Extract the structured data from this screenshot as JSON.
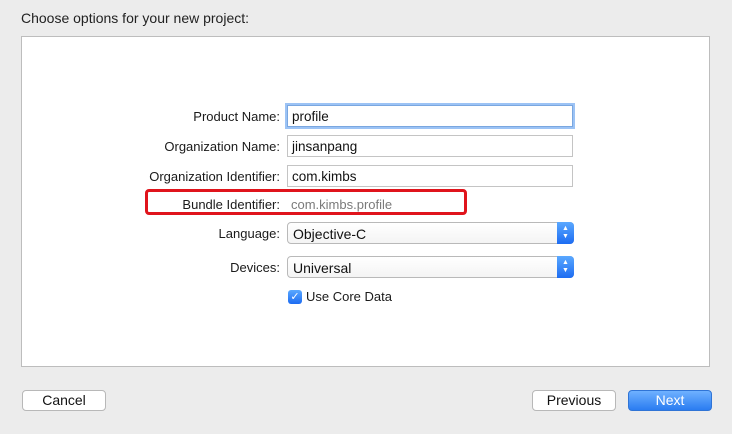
{
  "sheet": {
    "title": "Choose options for your new project:"
  },
  "form": {
    "product_name": {
      "label": "Product Name:",
      "value": "profile"
    },
    "organization_name": {
      "label": "Organization Name:",
      "value": "jinsanpang"
    },
    "organization_identifier": {
      "label": "Organization Identifier:",
      "value": "com.kimbs"
    },
    "bundle_identifier": {
      "label": "Bundle Identifier:",
      "value": "com.kimbs.profile"
    },
    "language": {
      "label": "Language:",
      "value": "Objective-C"
    },
    "devices": {
      "label": "Devices:",
      "value": "Universal"
    },
    "use_core_data": {
      "label": "Use Core Data",
      "checked": true
    }
  },
  "buttons": {
    "cancel": "Cancel",
    "previous": "Previous",
    "next": "Next"
  },
  "colors": {
    "accent": "#2a7cf1",
    "highlight_border": "#e0141c"
  },
  "icons": {
    "popup_arrows": "up-down-chevron-icon",
    "checkbox": "checkmark-icon"
  }
}
